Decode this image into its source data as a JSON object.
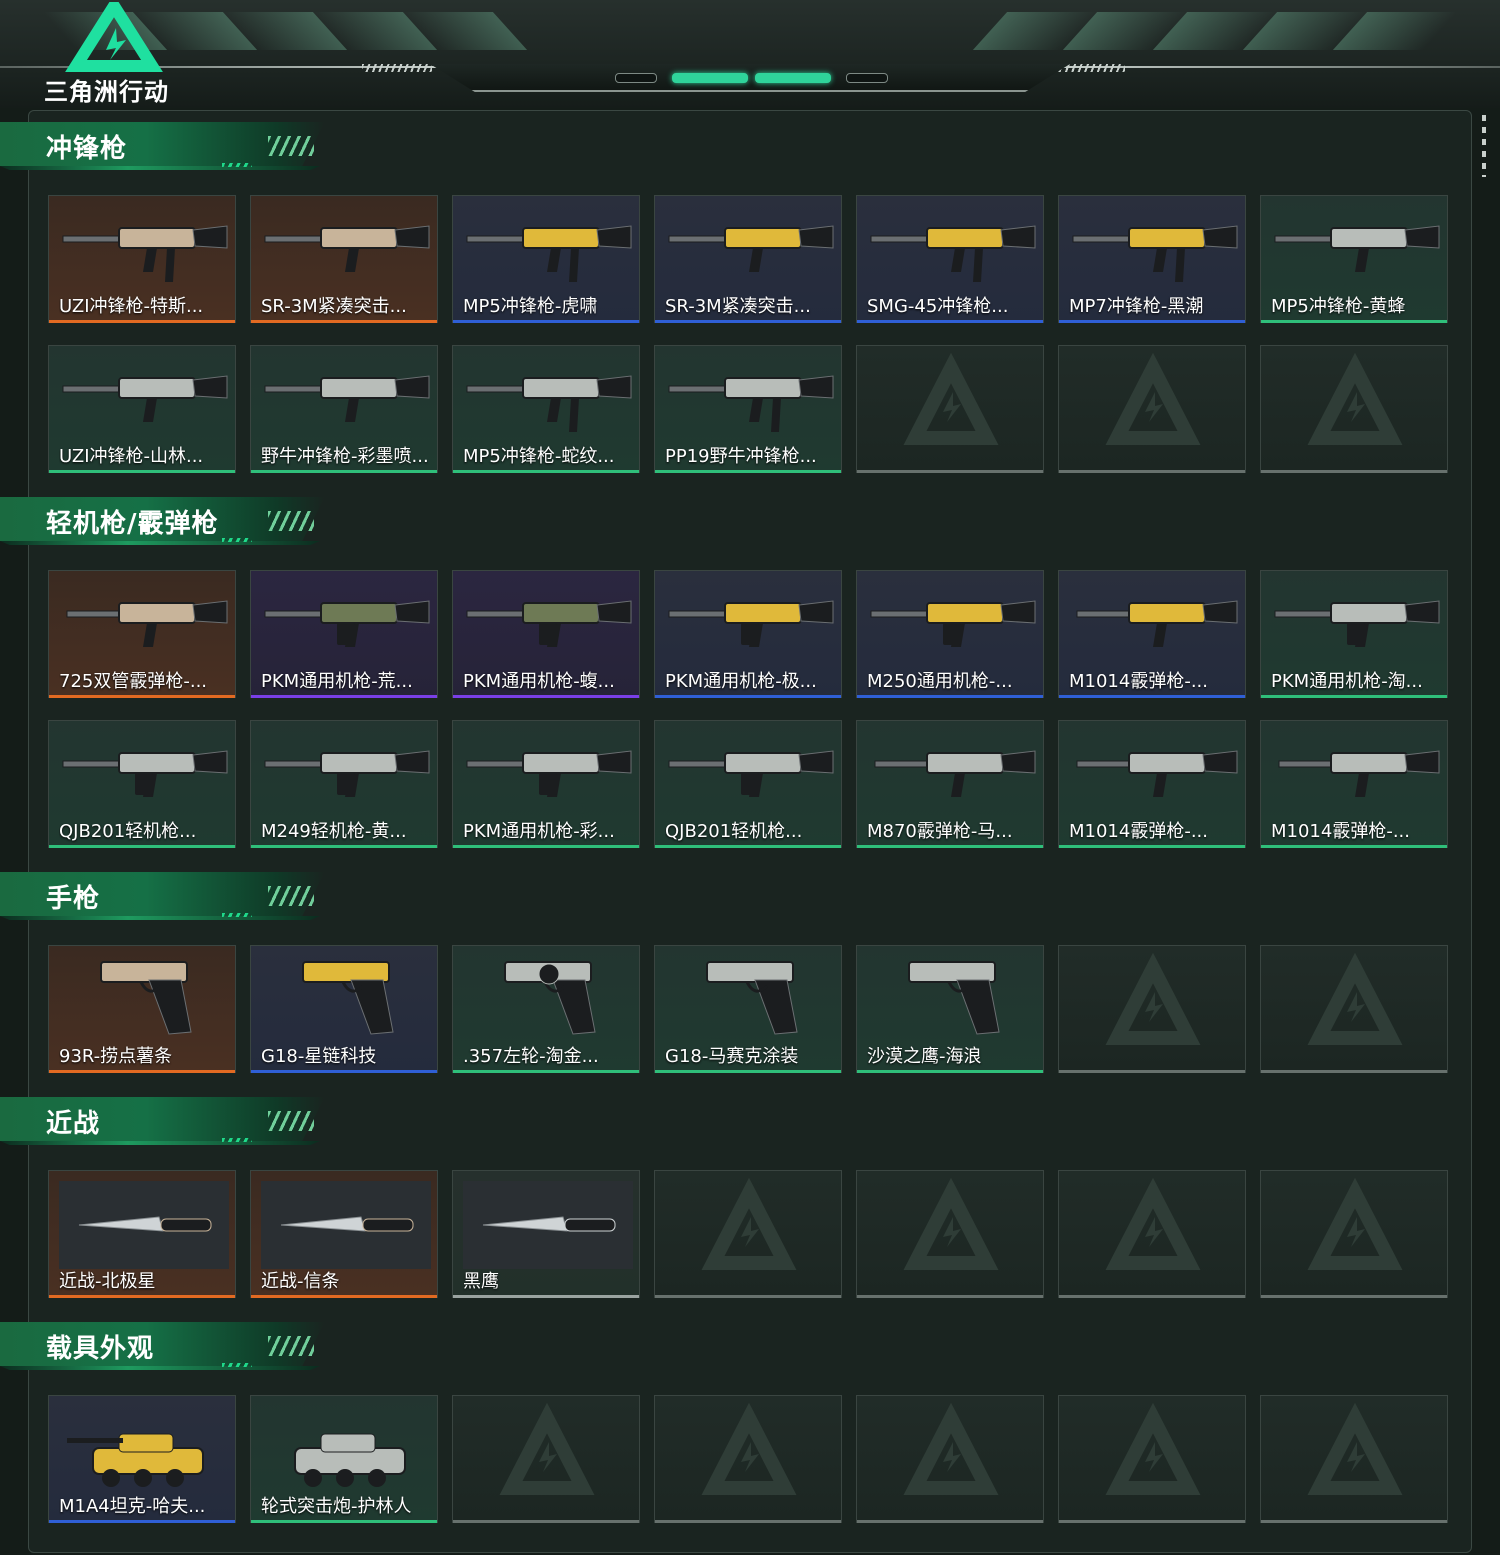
{
  "brand": {
    "logo_text": "三角洲行动"
  },
  "colors": {
    "orange": "#e26a22",
    "blue": "#2f5fd6",
    "green": "#2fbf7a",
    "purple": "#7a3fe6",
    "grey": "#9aa3a0",
    "accent": "#2fd39a"
  },
  "sections": [
    {
      "title": "冲锋枪",
      "items": [
        {
          "label": "UZI冲锋枪-特斯...",
          "rarity": "orange",
          "icon": "smg-icon"
        },
        {
          "label": "SR-3M紧凑突击...",
          "rarity": "orange",
          "icon": "rifle-icon"
        },
        {
          "label": "MP5冲锋枪-虎啸",
          "rarity": "blue",
          "icon": "smg-icon"
        },
        {
          "label": "SR-3M紧凑突击...",
          "rarity": "blue",
          "icon": "rifle-icon"
        },
        {
          "label": "SMG-45冲锋枪...",
          "rarity": "blue",
          "icon": "smg-icon"
        },
        {
          "label": "MP7冲锋枪-黑潮",
          "rarity": "blue",
          "icon": "smg-icon"
        },
        {
          "label": "MP5冲锋枪-黄蜂",
          "rarity": "green",
          "icon": "rifle-icon"
        },
        {
          "label": "UZI冲锋枪-山林...",
          "rarity": "green",
          "icon": "rifle-icon"
        },
        {
          "label": "野牛冲锋枪-彩墨喷...",
          "rarity": "green",
          "icon": "rifle-icon"
        },
        {
          "label": "MP5冲锋枪-蛇纹...",
          "rarity": "green",
          "icon": "smg-icon"
        },
        {
          "label": "PP19野牛冲锋枪...",
          "rarity": "green",
          "icon": "smg-icon"
        },
        {
          "label": "",
          "rarity": "empty"
        },
        {
          "label": "",
          "rarity": "empty"
        },
        {
          "label": "",
          "rarity": "empty"
        }
      ]
    },
    {
      "title": "轻机枪/霰弹枪",
      "items": [
        {
          "label": "725双管霰弹枪-...",
          "rarity": "orange",
          "icon": "shotgun-icon"
        },
        {
          "label": "PKM通用机枪-荒...",
          "rarity": "purple",
          "icon": "lmg-icon"
        },
        {
          "label": "PKM通用机枪-蝮...",
          "rarity": "purple",
          "icon": "lmg-icon"
        },
        {
          "label": "PKM通用机枪-极...",
          "rarity": "blue",
          "icon": "lmg-icon"
        },
        {
          "label": "M250通用机枪-...",
          "rarity": "blue",
          "icon": "lmg-icon"
        },
        {
          "label": "M1014霰弹枪-...",
          "rarity": "blue",
          "icon": "shotgun-icon"
        },
        {
          "label": "PKM通用机枪-淘...",
          "rarity": "green",
          "icon": "lmg-icon"
        },
        {
          "label": "QJB201轻机枪...",
          "rarity": "green",
          "icon": "lmg-icon"
        },
        {
          "label": "M249轻机枪-黄...",
          "rarity": "green",
          "icon": "lmg-icon"
        },
        {
          "label": "PKM通用机枪-彩...",
          "rarity": "green",
          "icon": "lmg-icon"
        },
        {
          "label": "QJB201轻机枪...",
          "rarity": "green",
          "icon": "lmg-icon"
        },
        {
          "label": "M870霰弹枪-马...",
          "rarity": "green",
          "icon": "shotgun-icon"
        },
        {
          "label": "M1014霰弹枪-...",
          "rarity": "green",
          "icon": "shotgun-icon"
        },
        {
          "label": "M1014霰弹枪-...",
          "rarity": "green",
          "icon": "shotgun-icon"
        }
      ]
    },
    {
      "title": "手枪",
      "items": [
        {
          "label": "93R-捞点薯条",
          "rarity": "orange",
          "icon": "pistol-icon"
        },
        {
          "label": "G18-星链科技",
          "rarity": "blue",
          "icon": "pistol-icon"
        },
        {
          "label": ".357左轮-淘金...",
          "rarity": "green",
          "icon": "revolver-icon"
        },
        {
          "label": "G18-马赛克涂装",
          "rarity": "green",
          "icon": "pistol-icon"
        },
        {
          "label": "沙漠之鹰-海浪",
          "rarity": "green",
          "icon": "pistol-icon"
        },
        {
          "label": "",
          "rarity": "empty"
        },
        {
          "label": "",
          "rarity": "empty"
        }
      ]
    },
    {
      "title": "近战",
      "items": [
        {
          "label": "近战-北极星",
          "rarity": "orange",
          "icon": "knife-icon"
        },
        {
          "label": "近战-信条",
          "rarity": "orange",
          "icon": "knife-icon"
        },
        {
          "label": "黑鹰",
          "rarity": "grey",
          "icon": "knife-icon"
        },
        {
          "label": "",
          "rarity": "empty"
        },
        {
          "label": "",
          "rarity": "empty"
        },
        {
          "label": "",
          "rarity": "empty"
        },
        {
          "label": "",
          "rarity": "empty"
        }
      ]
    },
    {
      "title": "载具外观",
      "items": [
        {
          "label": "M1A4坦克-哈夫...",
          "rarity": "blue",
          "icon": "tank-icon"
        },
        {
          "label": "轮式突击炮-护林人",
          "rarity": "green",
          "icon": "armored-vehicle-icon"
        },
        {
          "label": "",
          "rarity": "empty"
        },
        {
          "label": "",
          "rarity": "empty"
        },
        {
          "label": "",
          "rarity": "empty"
        },
        {
          "label": "",
          "rarity": "empty"
        },
        {
          "label": "",
          "rarity": "empty"
        }
      ]
    }
  ]
}
